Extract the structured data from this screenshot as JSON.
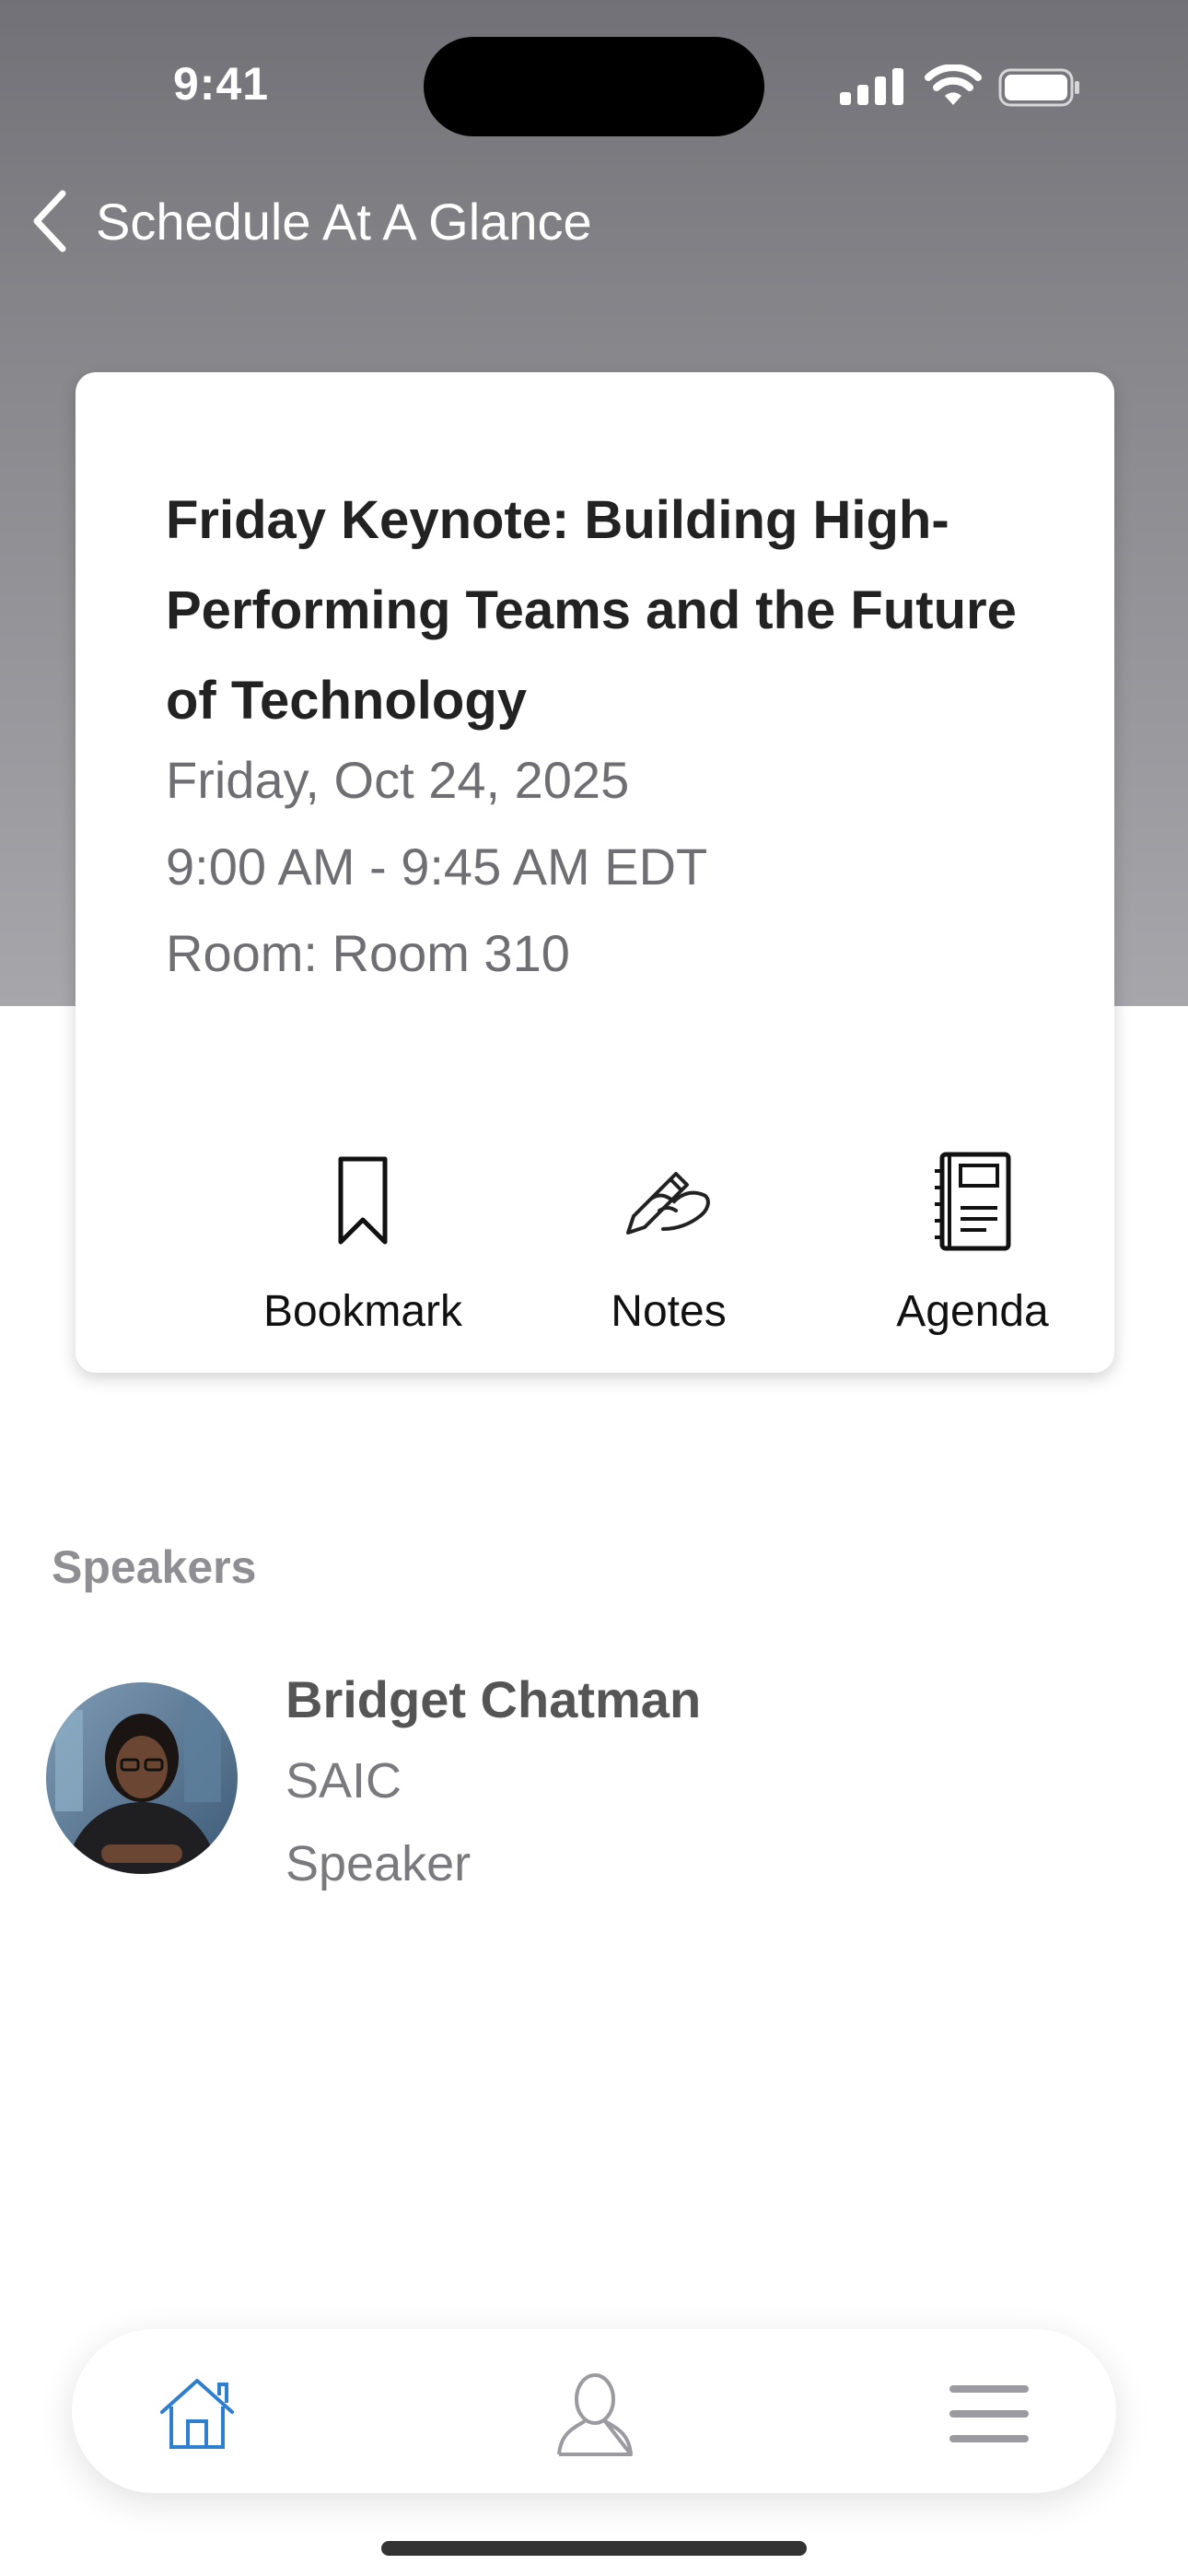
{
  "status_bar": {
    "time": "9:41"
  },
  "nav": {
    "title": "Schedule At A Glance"
  },
  "session": {
    "title": "Friday Keynote: Building High-Performing Teams and the Future of Technology",
    "date": "Friday, Oct 24, 2025",
    "time": "9:00 AM - 9:45 AM EDT",
    "room": "Room: Room 310"
  },
  "actions": [
    {
      "label": "Bookmark",
      "icon": "bookmark-icon"
    },
    {
      "label": "Notes",
      "icon": "pen-hand-icon"
    },
    {
      "label": "Agenda",
      "icon": "notebook-icon"
    }
  ],
  "speakers": {
    "heading": "Speakers",
    "items": [
      {
        "name": "Bridget Chatman",
        "organization": "SAIC",
        "role": "Speaker"
      }
    ]
  },
  "tabbar": {
    "tabs": [
      {
        "icon": "home-icon",
        "active": true
      },
      {
        "icon": "profile-icon",
        "active": false
      },
      {
        "icon": "menu-icon",
        "active": false
      }
    ]
  },
  "colors": {
    "accent": "#2f7fd1",
    "header_gradient_top": "#717177",
    "header_gradient_bottom": "#a6a6ab"
  }
}
